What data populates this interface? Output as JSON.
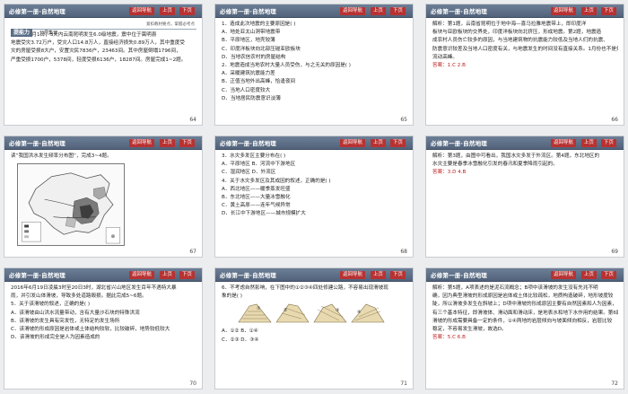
{
  "header": {
    "title": "必修第一册·自然地理",
    "nav_label": "返回导航",
    "prev_label": "上页",
    "next_label": "下页"
  },
  "slides": [
    {
      "page": "64",
      "section_tag": "提能力",
      "section_sub": "分层集训",
      "hint": "紧扣教材要点，掌握必考点",
      "lines": [
        "2012年1月1日，3天内云南昆明发生6.0级地震，震中位于嵩明县",
        "地震受灾3.72万户，受灾人口14.8万人，直接经济损失0.89万人，其中重度受",
        "灾的房屋受损8大户，安置灾民7836户，23463间。其中房屋倒塌1796间，",
        "严重受损1700户，5378间，轻度受损6136户，18287间。房屋完成1~2题。"
      ]
    },
    {
      "page": "65",
      "lines": [
        "1．造成此次地震的主要原因是(    )",
        "A．地处亚太山洞带地震带",
        "B．平原地区，地壳较薄",
        "C．印度洋板块向北部压碰亚欧板块",
        "D．当地农信农村的房屋结构",
        "2．地震造成当地农村大量人员受伤，与之无关的原因是(    )",
        "A．采暖建筑抗震能力差",
        "B．正值当地外出高峰，恰逢夜间",
        "C．当地人口密度较大",
        "D．当地居民防震意识淡薄"
      ]
    },
    {
      "page": "66",
      "lines": [
        "解析：第1题，云南省昆明位于地中海—喜马拉雅地震带上，即印度洋",
        "板块与亚欧板块的交界处，印度洋板块向北挤压，形成地震。第2题，地震造",
        "成农村人员伤亡较多的原因，与当地建筑物的抗震能力较低及当地人们的抗震、",
        "防震意识较差及当地人口密度有关，与地震发生的时间没有直接关系。1月份也不是外出",
        "流动高峰。"
      ],
      "answer": "答案：1.C  2.B"
    },
    {
      "page": "67",
      "lines": [
        "读“我国洪水发生频率分布图”，完成3~4题。"
      ]
    },
    {
      "page": "68",
      "lines": [
        "3．水灾多发区主要分布在(    )",
        "A．平原地区          B．河流中下游地区",
        "C．湿润地区          D．外流区",
        "4．关于水灾多发区及其成因的叙述，正确的是(    )",
        "A．西北地区——暖季蒸发旺盛",
        "B．东北地区——大量冰雪融化",
        "C．黄土高原——连年气候异常",
        "D．长江中下游地区——城市规模扩大"
      ]
    },
    {
      "page": "69",
      "lines": [
        "解析：第3题，由图中可看出，我国水灾多发于外流区。第4题，东北地区的",
        "水灾主要是春季冰雪融化引发的春汛和夏季降雨引起的。"
      ],
      "answer": "答案：3.D  4.B"
    },
    {
      "page": "70",
      "lines": [
        "2016年6月19日凌晨3时至20日3时，湖北省兴山地区发生百年不遇特大暴",
        "雨，并引发山体滑坡，导致多处道路毁损。据此完成5~6题。",
        "5．关于该滑坡的叙述，正确的是(    )",
        "A．该滑坡由山洪水流量带动，含有大量沙石块的特殊洪流",
        "B．该滑坡的发生具有突发性，无特定的发生场所",
        "C．该滑坡的形成原因是岩体或土体结构较软，比较破碎，地势较低较大",
        "D．该滑坡的形成完全是人为因素造成的"
      ]
    },
    {
      "page": "71",
      "lines": [
        "6．不考虑自然影响，在下图中的①②③④四处修建公路，不容易出现滑坡现",
        "象的是(    )"
      ],
      "choices": [
        "A．①②    B．①④",
        "C．②③    D．③④"
      ],
      "terrain_labels": [
        "①",
        "②",
        "③",
        "④"
      ]
    },
    {
      "page": "72",
      "lines": [
        "解析：第5题，A项表述的是泥石流概念；B项中该滑坡的发生没有先兆不明",
        "确，因为典型滑坡的形成原因是岩体或土体比较疏松，地质构造破碎，地形坡度较",
        "陡，所以滑坡多发生在斜坡上；D项中滑坡的形成原因主要有自然因素和人为因素，",
        "有三个基本特征，即滑坡体、滑动面和滑动床，是地表水和地下水作用的结果。第6题，",
        "滑坡的形成需要具备一定的条件，①④两地的岩层倾向与坡面倾向相反，岩层比较",
        "稳定，不容易发生滑坡，故选D。"
      ],
      "answer": "答案：5.C  6.B"
    }
  ],
  "colors": {
    "header": "#5c6e86",
    "button": "#b83232",
    "answer": "#c02020"
  }
}
